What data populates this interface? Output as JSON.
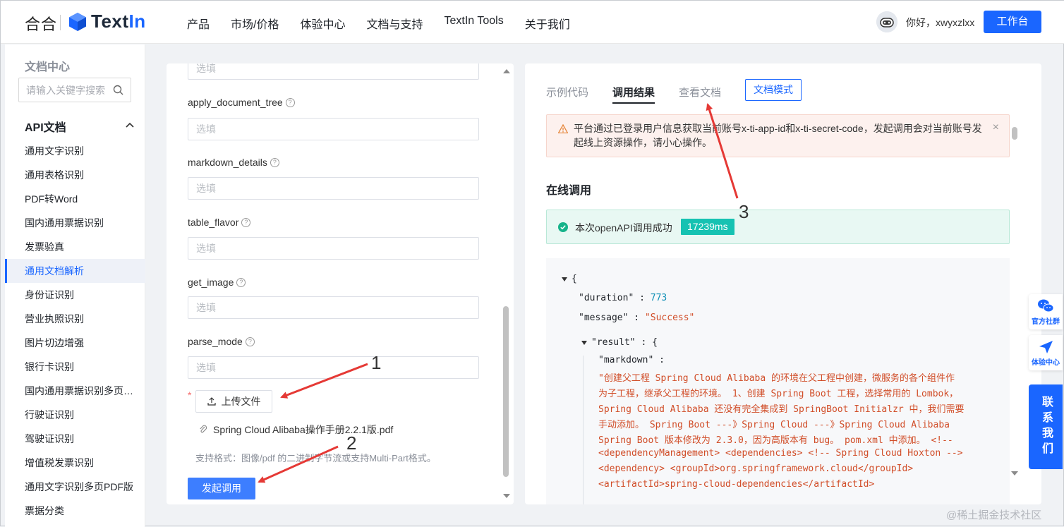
{
  "header": {
    "logo_hehe": "合合",
    "logo_text_a": "Text",
    "logo_text_b": "In",
    "nav": [
      "产品",
      "市场/价格",
      "体验中心",
      "文档与支持",
      "TextIn Tools",
      "关于我们"
    ],
    "greeting": "你好，xwyxzlxx",
    "workbench": "工作台"
  },
  "sidebar": {
    "title": "文档中心",
    "search_placeholder": "请输入关键字搜索",
    "section": "API文档",
    "items": [
      {
        "label": "通用文字识别",
        "active": false
      },
      {
        "label": "通用表格识别",
        "active": false
      },
      {
        "label": "PDF转Word",
        "active": false
      },
      {
        "label": "国内通用票据识别",
        "active": false
      },
      {
        "label": "发票验真",
        "active": false
      },
      {
        "label": "通用文档解析",
        "active": true
      },
      {
        "label": "身份证识别",
        "active": false
      },
      {
        "label": "营业执照识别",
        "active": false
      },
      {
        "label": "图片切边增强",
        "active": false
      },
      {
        "label": "银行卡识别",
        "active": false
      },
      {
        "label": "国内通用票据识别多页PDF版",
        "active": false
      },
      {
        "label": "行驶证识别",
        "active": false
      },
      {
        "label": "驾驶证识别",
        "active": false
      },
      {
        "label": "增值税发票识别",
        "active": false
      },
      {
        "label": "通用文字识别多页PDF版",
        "active": false
      },
      {
        "label": "票据分类",
        "active": false
      }
    ]
  },
  "form": {
    "placeholder": "选填",
    "fields": [
      "apply_document_tree",
      "markdown_details",
      "table_flavor",
      "get_image",
      "parse_mode"
    ],
    "required_mark": "*",
    "upload_label": "上传文件",
    "file_name": "Spring Cloud Alibaba操作手册2.2.1版.pdf",
    "format_tip": "支持格式：图像/pdf 的二进制字节流或支持Multi-Part格式。",
    "submit_label": "发起调用"
  },
  "result": {
    "tabs": [
      "示例代码",
      "调用结果",
      "查看文档"
    ],
    "active_tab": "调用结果",
    "mode_button": "文档模式",
    "warning": "平台通过已登录用户信息获取当前账号x-ti-app-id和x-ti-secret-code，发起调用会对当前账号发起线上资源操作，请小心操作。",
    "warning_close": "×",
    "section_title": "在线调用",
    "success_text": "本次openAPI调用成功",
    "time_badge": "17239ms",
    "json": {
      "open_brace": "{",
      "duration_key": "\"duration\"",
      "duration_val": "773",
      "message_key": "\"message\"",
      "message_val": "\"Success\"",
      "result_key": "\"result\"",
      "markdown_key": "\"markdown\"",
      "colon": ":",
      "markdown_lines": [
        "\"创建父工程 Spring Cloud Alibaba 的环境在父工程中创建，微服务的各个组件作",
        "为子工程，继承父工程的环境。 1、创建 Spring Boot 工程，选择常用的 Lombok，",
        "Spring Cloud Alibaba 还没有完全集成到 SpringBoot Initialzr 中，我们需要",
        "手动添加。 Spring Boot ---》Spring Cloud ---》Spring Cloud Alibaba",
        "Spring Boot 版本修改为 2.3.0，因为高版本有 bug。 pom.xml 中添加。 <!--",
        "<dependencyManagement> <dependencies> <!-- Spring Cloud Hoxton -->",
        "<dependency> <groupId>org.springframework.cloud</groupId>",
        "<artifactId>spring-cloud-dependencies</artifactId>"
      ]
    }
  },
  "floating": {
    "community": "官方社群",
    "experience": "体验中心",
    "contact": "联系我们"
  },
  "annotations": [
    "1",
    "2",
    "3"
  ],
  "watermark": "@稀土掘金技术社区",
  "colors": {
    "brand": "#1a66ff",
    "success_badge": "#16c2b2",
    "string": "#d14d28",
    "number": "#0f8fb5",
    "arrow": "#e53935"
  }
}
